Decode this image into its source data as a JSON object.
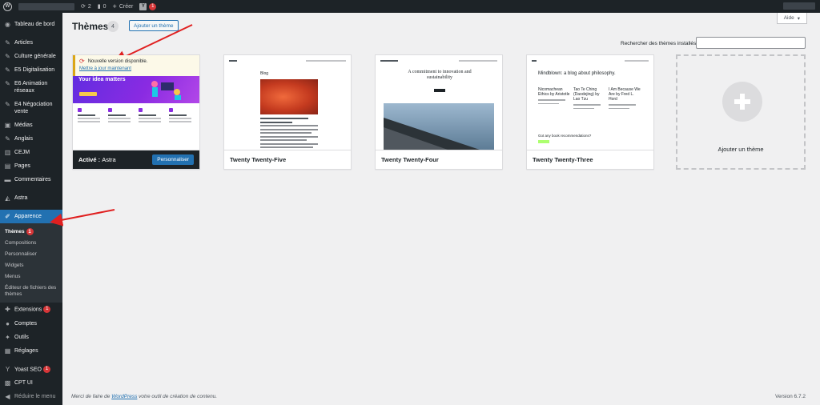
{
  "adminbar": {
    "updates_count": "2",
    "comments_count": "0",
    "create_label": "Créer",
    "yoast_badge": "1"
  },
  "sidebar": {
    "items": [
      {
        "label": "Tableau de bord",
        "icon": "dashboard-icon"
      },
      {
        "label": "Articles",
        "icon": "pin-icon"
      },
      {
        "label": "Culture générale",
        "icon": "pin-icon"
      },
      {
        "label": "E5 Digitalisation",
        "icon": "pin-icon"
      },
      {
        "label": "E6 Animation réseaux",
        "icon": "pin-icon"
      },
      {
        "label": "E4 Négociation vente",
        "icon": "pin-icon"
      },
      {
        "label": "Médias",
        "icon": "media-icon"
      },
      {
        "label": "Anglais",
        "icon": "pin-icon"
      },
      {
        "label": "CEJM",
        "icon": "pin-icon"
      },
      {
        "label": "Pages",
        "icon": "page-icon"
      },
      {
        "label": "Commentaires",
        "icon": "comment-icon"
      },
      {
        "label": "Astra",
        "icon": "astra-icon"
      },
      {
        "label": "Apparence",
        "icon": "brush-icon"
      },
      {
        "label": "Extensions",
        "icon": "plugin-icon",
        "badge": "1"
      },
      {
        "label": "Comptes",
        "icon": "user-icon"
      },
      {
        "label": "Outils",
        "icon": "wrench-icon"
      },
      {
        "label": "Réglages",
        "icon": "settings-icon"
      },
      {
        "label": "Yoast SEO",
        "icon": "yoast-icon",
        "badge": "1"
      },
      {
        "label": "CPT UI",
        "icon": "cpt-icon"
      },
      {
        "label": "Réduire le menu",
        "icon": "collapse-icon"
      }
    ],
    "submenu": {
      "themes": "Thèmes",
      "themes_badge": "1",
      "compositions": "Compositions",
      "personnaliser": "Personnaliser",
      "widgets": "Widgets",
      "menus": "Menus",
      "editor": "Éditeur de fichiers des thèmes"
    }
  },
  "header": {
    "title": "Thèmes",
    "count": "4",
    "add_button": "Ajouter un thème",
    "help_button": "Aide",
    "search_label": "Rechercher des thèmes installés",
    "search_value": ""
  },
  "themes": {
    "astra": {
      "notice_text": "Nouvelle version disponible.",
      "notice_link": "Mettre à jour maintenant",
      "hero_text": "Your idea matters",
      "features": [
        "Local Business",
        "Online Store",
        "Blogging",
        "Portfolio"
      ],
      "active_prefix": "Activé :",
      "active_name": "Astra",
      "customize_button": "Personnaliser"
    },
    "tt5": {
      "name": "Twenty Twenty-Five",
      "blog_label": "Blog"
    },
    "tt4": {
      "name": "Twenty Twenty-Four",
      "heading": "A commitment to innovation and sustainability"
    },
    "tt3": {
      "name": "Twenty Twenty-Three",
      "title": "Mindblown: a blog about philosophy.",
      "col1": "Nicomachean Ethics by Aristotle",
      "col2": "Tao Te Ching (Daodejing) by Lao Tzu",
      "col3": "I Am Because We Are by Fred L. Hord",
      "question": "Got any book recommendations?"
    },
    "add_new_label": "Ajouter un thème"
  },
  "footer": {
    "left_prefix": "Merci de faire de ",
    "left_link": "WordPress",
    "left_suffix": " votre outil de création de contenu.",
    "version": "Version 6.7.2"
  },
  "colors": {
    "admin_dark": "#1d2327",
    "accent_blue": "#2271b1",
    "badge_red": "#d63638",
    "annotation_red": "#e02020"
  }
}
